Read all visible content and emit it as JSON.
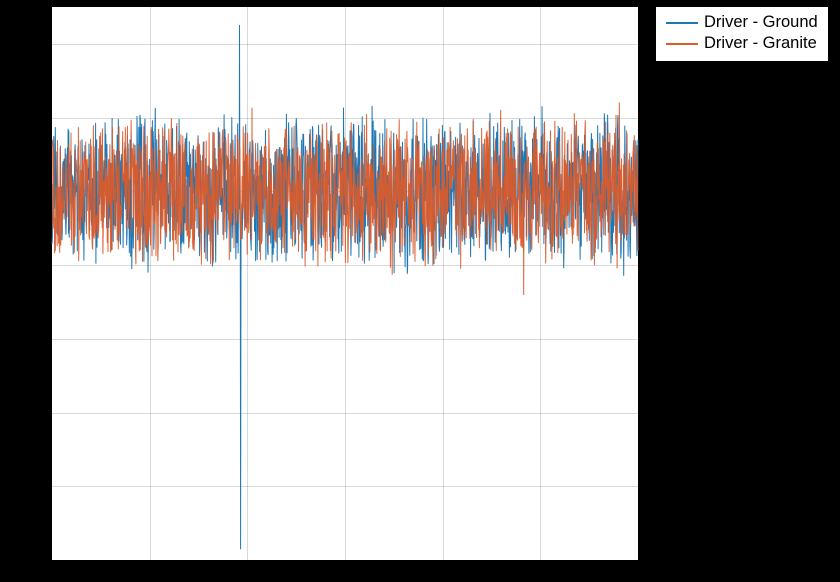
{
  "legend": {
    "items": [
      {
        "label": "Driver - Ground",
        "color": "#1f77b4"
      },
      {
        "label": "Driver - Granite",
        "color": "#d95b2c"
      }
    ]
  },
  "colors": {
    "blue": "#1f77b4",
    "orange": "#d95b2c"
  },
  "chart_data": {
    "type": "line",
    "title": "",
    "xlabel": "",
    "ylabel": "",
    "xlim": [
      0,
      6
    ],
    "ylim": [
      -100,
      50
    ],
    "xticks": [
      0,
      1,
      2,
      3,
      4,
      5,
      6
    ],
    "yticks": [
      -100,
      -80,
      -60,
      -40,
      -20,
      0,
      20,
      40
    ],
    "grid": true,
    "legend_position": "outside upper right",
    "note": "High-density noisy time series; envelope/anomaly summary below.",
    "series": [
      {
        "name": "Driver - Ground",
        "color": "#1f77b4",
        "baseline": 0,
        "noise_envelope": [
          -18,
          18
        ],
        "anomalies": [
          {
            "x": 1.92,
            "y": 45
          },
          {
            "x": 1.93,
            "y": -97
          }
        ]
      },
      {
        "name": "Driver - Granite",
        "color": "#d95b2c",
        "baseline": 0,
        "noise_envelope": [
          -16,
          18
        ],
        "anomalies": [
          {
            "x": 4.83,
            "y": -28
          },
          {
            "x": 5.81,
            "y": 24
          }
        ]
      }
    ]
  }
}
